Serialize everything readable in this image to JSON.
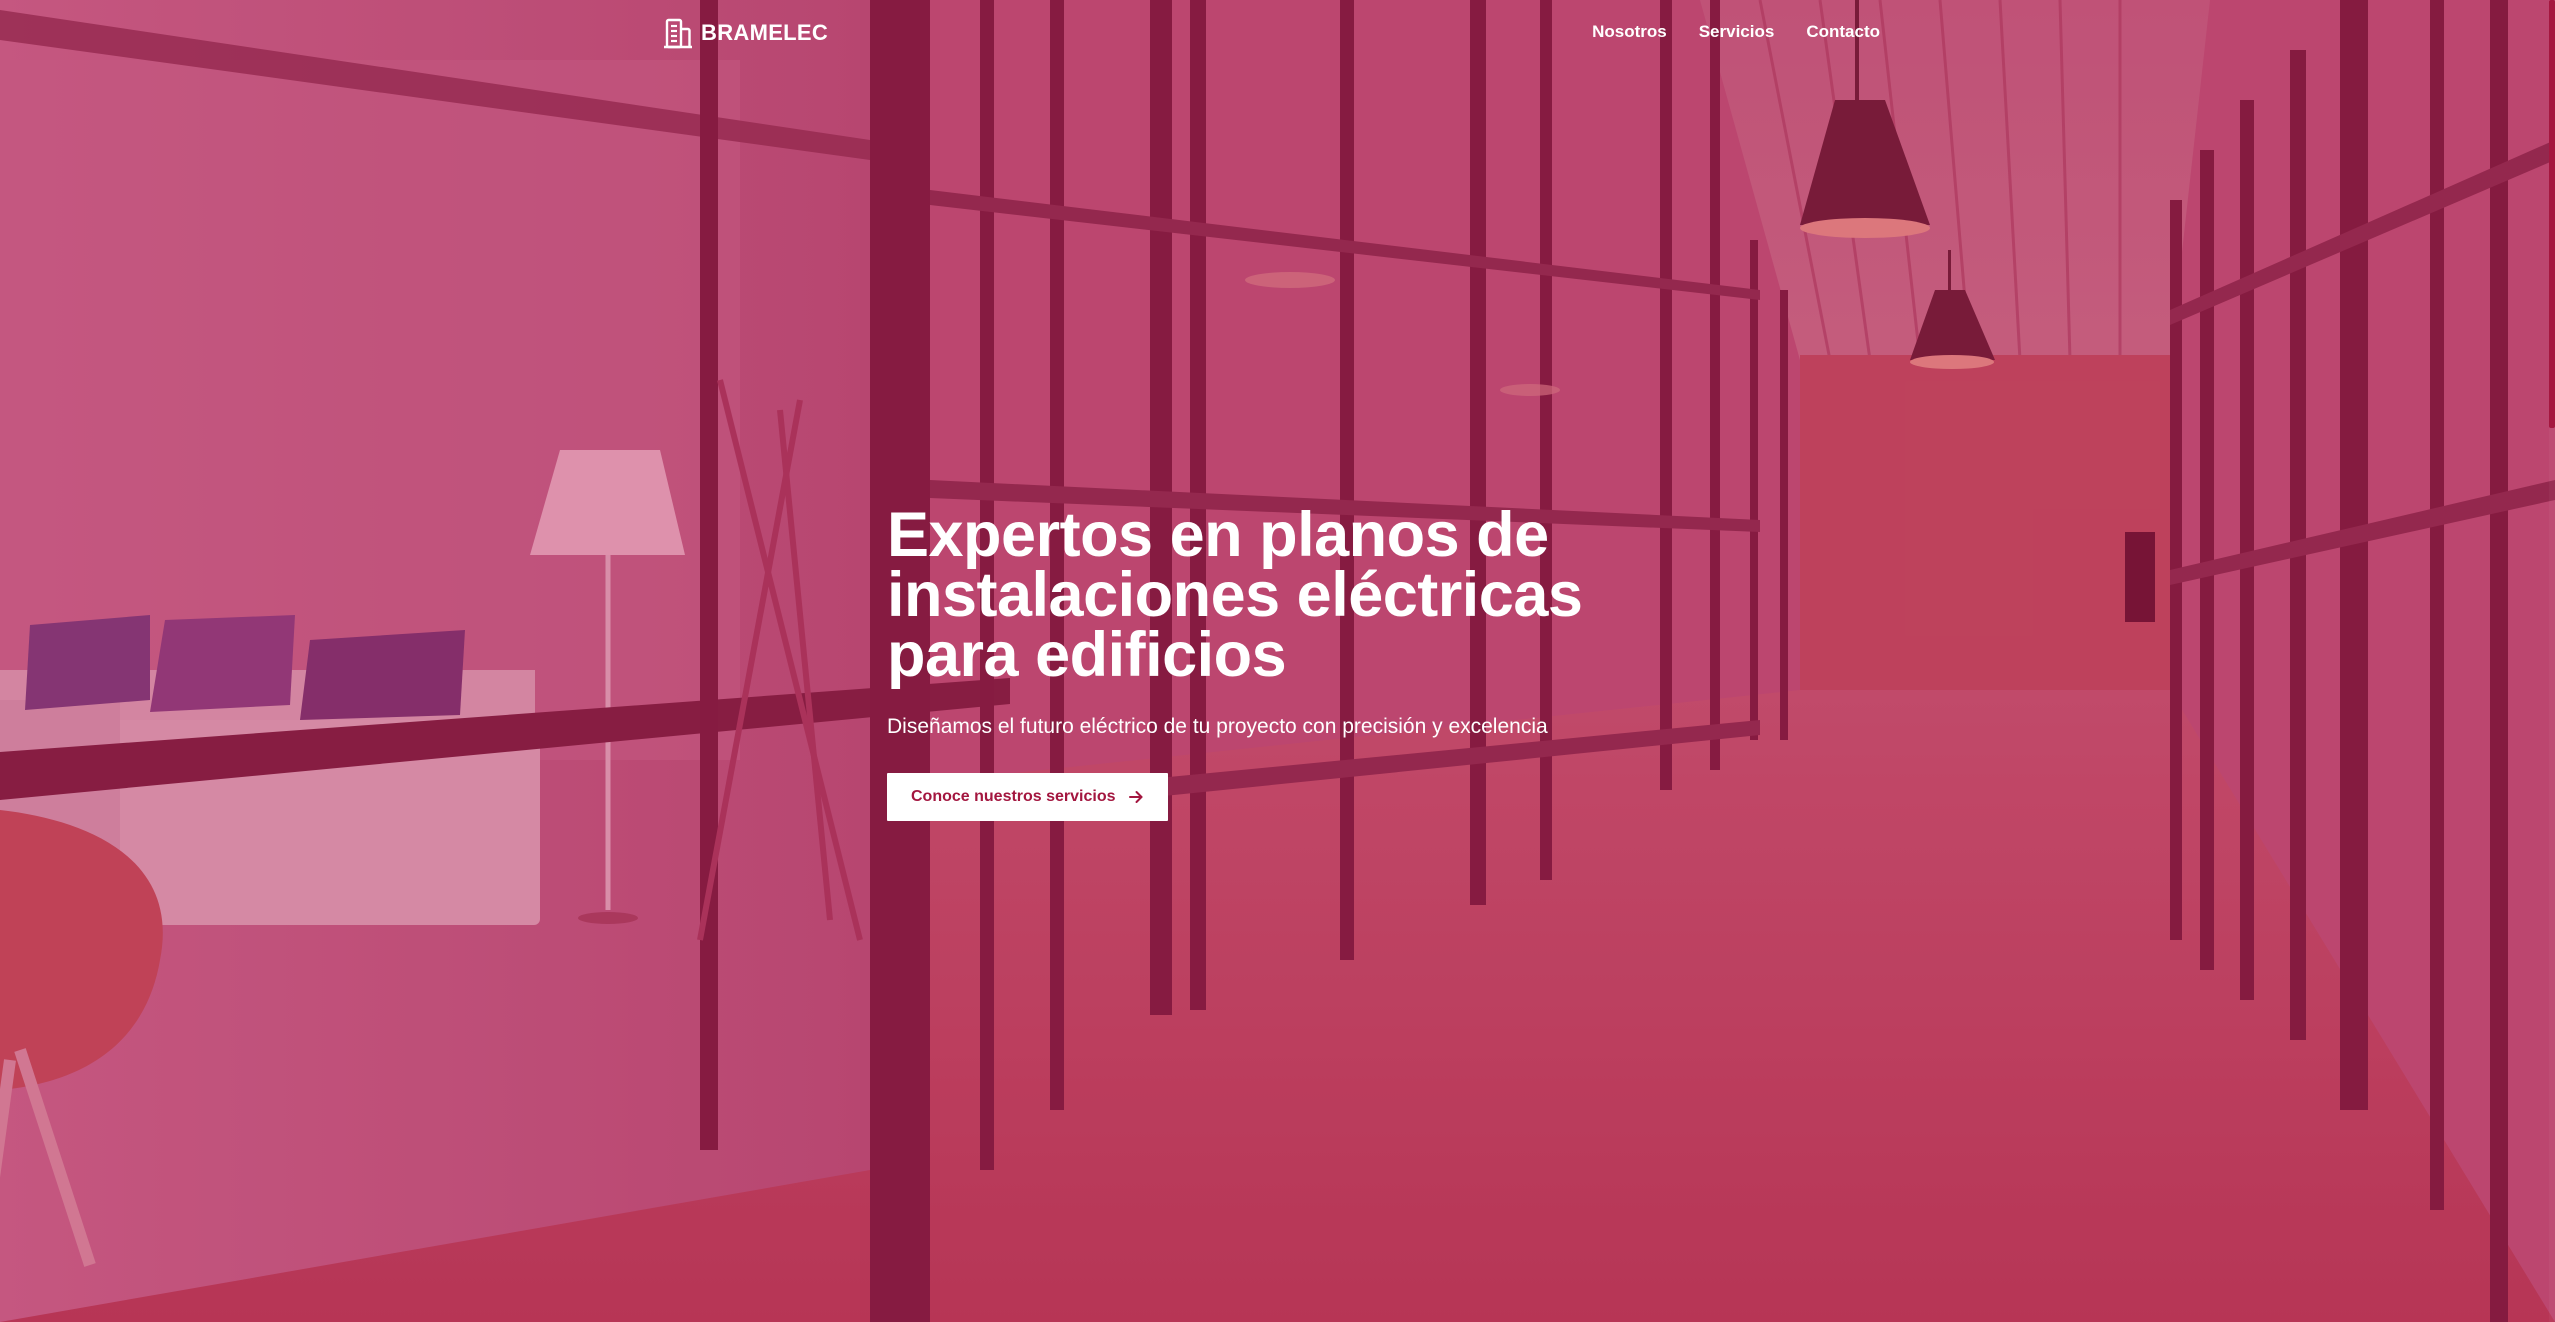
{
  "header": {
    "brand_name": "BRAMELEC",
    "brand_icon": "building-icon",
    "nav": [
      {
        "label": "Nosotros"
      },
      {
        "label": "Servicios"
      },
      {
        "label": "Contacto"
      }
    ]
  },
  "hero": {
    "title_lines": [
      "Expertos en planos de",
      "instalaciones eléctricas",
      "para edificios"
    ],
    "subtitle": "Diseñamos el futuro eléctrico de tu proyecto con precisión y excelencia",
    "cta_label": "Conoce nuestros servicios",
    "cta_icon": "arrow-right-icon"
  },
  "colors": {
    "overlay_tint": "#b6466c",
    "button_background": "#ffffff",
    "button_text": "#a3163f",
    "scrollbar_thumb": "#a5173f"
  }
}
